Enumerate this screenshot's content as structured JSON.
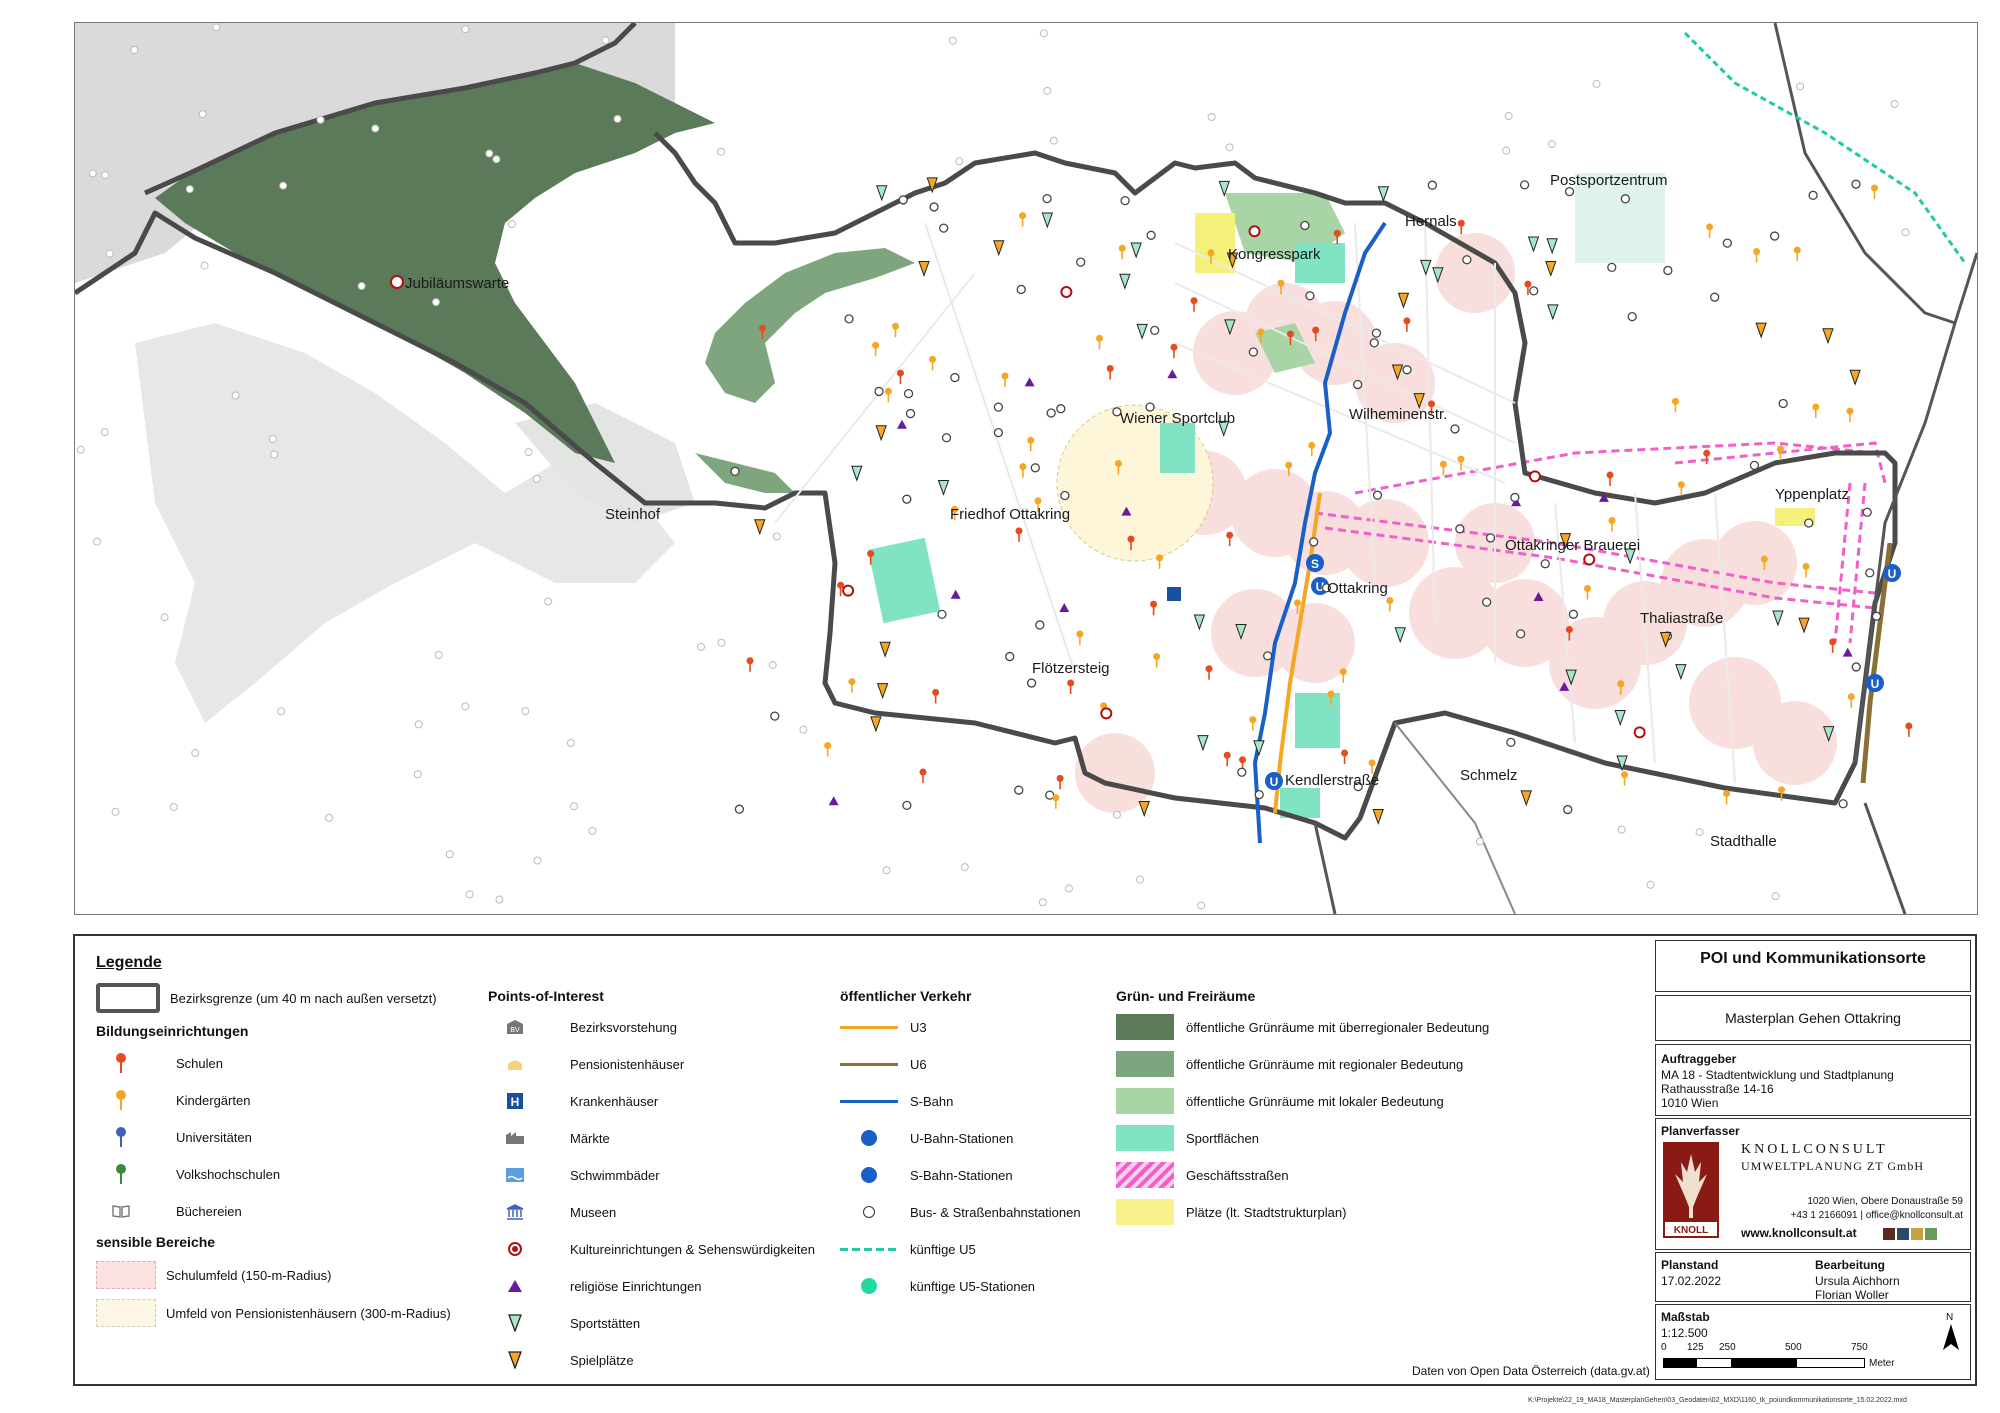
{
  "map": {
    "places": [
      {
        "id": "jubilaeumswarte",
        "text": "Jubiläumswarte"
      },
      {
        "id": "kongresspark",
        "text": "Kongresspark"
      },
      {
        "id": "hernals",
        "text": "Hernals"
      },
      {
        "id": "postsportzentrum",
        "text": "Postsportzentrum"
      },
      {
        "id": "wiener-sportclub",
        "text": "Wiener Sportclub"
      },
      {
        "id": "wilhelminenstr",
        "text": "Wilheminenstr."
      },
      {
        "id": "steinhof",
        "text": "Steinhof"
      },
      {
        "id": "friedhof-ottakring",
        "text": "Friedhof Ottakring"
      },
      {
        "id": "ottakringer-brauerei",
        "text": "Ottakringer Brauerei"
      },
      {
        "id": "yppenplatz",
        "text": "Yppenplatz"
      },
      {
        "id": "ottakring",
        "text": "Ottakring"
      },
      {
        "id": "thaliastrasse",
        "text": "Thaliastraße"
      },
      {
        "id": "floetzersteig",
        "text": "Flötzersteig"
      },
      {
        "id": "kendlerstrasse",
        "text": "Kendlerstraße"
      },
      {
        "id": "schmelz",
        "text": "Schmelz"
      },
      {
        "id": "stadthalle",
        "text": "Stadthalle"
      }
    ],
    "colors": {
      "green_overregional": "#5a7a5a",
      "green_regional": "#7fa57f",
      "green_local": "#a9d4a5",
      "sport": "#7fe3c4",
      "school_zone": "#f7d9d6",
      "pension_zone": "#fdf6d8",
      "u3": "#f5a623",
      "u6": "#8a7035",
      "sbahn": "#1a5fc8",
      "u5": "#22c9a6",
      "district": "#4a4a4a",
      "shopping": "#f060c8",
      "squares": "#f5f07a",
      "background_hill": "#dadada"
    },
    "station_glyphs": {
      "sbahn": "S",
      "ubahn": "U"
    }
  },
  "legend": {
    "title": "Legende",
    "district_border": "Bezirksgrenze (um 40 m nach außen versetzt)",
    "education": {
      "heading": "Bildungseinrichtungen",
      "items": [
        "Schulen",
        "Kindergärten",
        "Universitäten",
        "Volkshochschulen",
        "Büchereien"
      ]
    },
    "sensitive": {
      "heading": "sensible Bereiche",
      "items": [
        "Schulumfeld (150-m-Radius)",
        "Umfeld von Pensionistenhäusern (300-m-Radius)"
      ]
    },
    "poi": {
      "heading": "Points-of-Interest",
      "items": [
        "Bezirksvorstehung",
        "Pensionistenhäuser",
        "Krankenhäuser",
        "Märkte",
        "Schwimmbäder",
        "Museen",
        "Kultureinrichtungen & Sehenswürdigkeiten",
        "religiöse Einrichtungen",
        "Sportstätten",
        "Spielplätze"
      ]
    },
    "transit": {
      "heading": "öffentlicher Verkehr",
      "items": [
        "U3",
        "U6",
        "S-Bahn",
        "U-Bahn-Stationen",
        "S-Bahn-Stationen",
        "Bus- & Straßenbahnstationen",
        "künftige U5",
        "künftige U5-Stationen"
      ]
    },
    "green": {
      "heading": "Grün- und Freiräume",
      "items": [
        "öffentliche Grünräume mit überregionaler Bedeutung",
        "öffentliche Grünräume mit regionaler Bedeutung",
        "öffentliche Grünräume mit lokaler Bedeutung",
        "Sportflächen",
        "Geschäftsstraßen",
        "Plätze (lt. Stadtstrukturplan)"
      ]
    },
    "source": "Daten von Open Data Österreich (data.gv.at)"
  },
  "titleblock": {
    "title": "POI und Kommunikationsorte",
    "subtitle": "Masterplan Gehen Ottakring",
    "client_label": "Auftraggeber",
    "client_lines": [
      "MA 18 - Stadtentwicklung und Stadtplanung",
      "Rathausstraße 14-16",
      "1010 Wien"
    ],
    "planner_label": "Planverfasser",
    "firm_line1": "KNOLLCONSULT",
    "firm_line2": "UMWELTPLANUNG ZT GmbH",
    "logo_text": "KNOLL",
    "firm_address": "1020 Wien, Obere Donaustraße 59",
    "firm_contact": "+43 1 2166091 | office@knollconsult.at",
    "firm_web": "www.knollconsult.at",
    "date_label": "Planstand",
    "date": "17.02.2022",
    "editor_label": "Bearbeitung",
    "editors": [
      "Ursula Aichhorn",
      "Florian Woller"
    ],
    "scale_label": "Maßstab",
    "scale": "1:12.500",
    "scale_ticks": [
      "0",
      "125",
      "250",
      "500",
      "750"
    ],
    "scale_unit": "Meter",
    "north": "N"
  },
  "filepath": "K:\\Projekte\\22_19_MA18_MasterplanGehen\\03_Geodaten\\02_MXD\\1160_tk_poiundkommunikationsorte_15.02.2022.mxd"
}
